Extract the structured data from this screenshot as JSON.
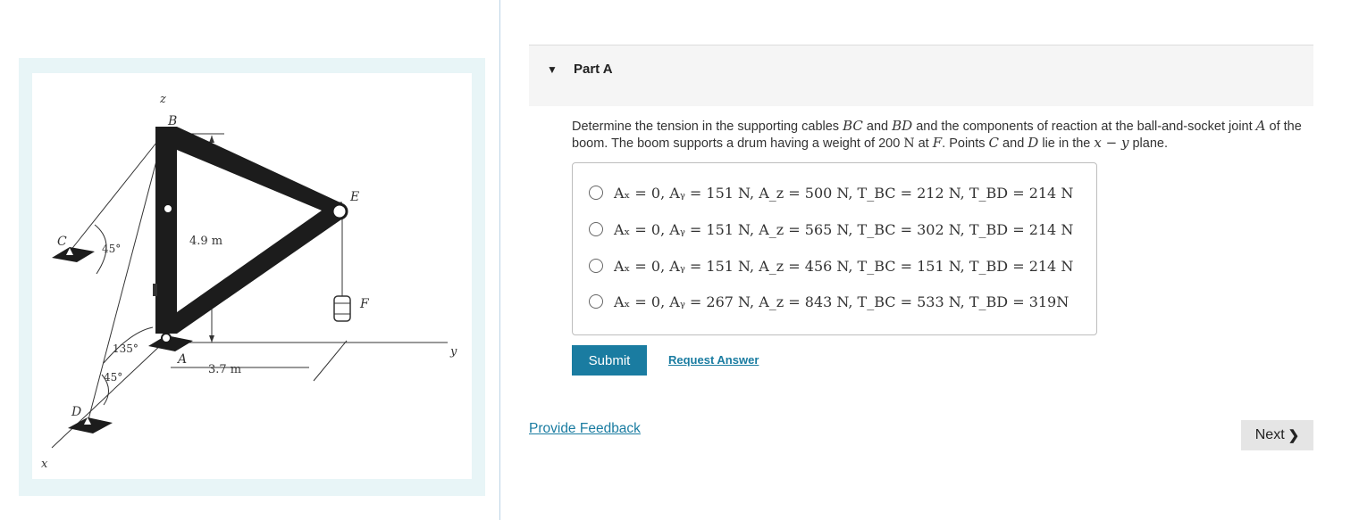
{
  "figure": {
    "labels": {
      "z": "z",
      "b": "B",
      "e": "E",
      "c": "C",
      "f": "F",
      "a": "A",
      "d": "D",
      "x": "x",
      "y": "y",
      "angle_c": "45°",
      "angle_d1": "135°",
      "angle_d2": "45°",
      "dim_height": "4.9 m",
      "dim_width": "3.7 m"
    }
  },
  "part": {
    "title": "Part A"
  },
  "question": {
    "t1": "Determine the tension in the supporting cables ",
    "m1": "BC",
    "t2": " and ",
    "m2": "BD",
    "t3": " and the components of reaction at the ball-and-socket joint ",
    "m3": "A",
    "t4": " of the boom. The boom supports a drum having a weight of 200 ",
    "m4": "N",
    "t5": " at ",
    "m5": "F",
    "t6": ". Points ",
    "m6": "C",
    "t7": " and ",
    "m7": "D",
    "t8": " lie in the ",
    "m8": "x − y",
    "t9": " plane."
  },
  "options": [
    {
      "text": "Aₓ = 0,  Aᵧ = 151 N,  A_z = 500 N,  T_BC = 212 N,  T_BD = 214 N"
    },
    {
      "text": "Aₓ = 0,  Aᵧ = 151 N,  A_z = 565 N,  T_BC = 302 N,  T_BD = 214 N"
    },
    {
      "text": "Aₓ = 0,  Aᵧ = 151 N,  A_z = 456 N,  T_BC = 151 N,  T_BD = 214 N"
    },
    {
      "text": "Aₓ = 0,  Aᵧ = 267 N,  A_z = 843 N,  T_BC = 533 N,  T_BD = 319N"
    }
  ],
  "buttons": {
    "submit": "Submit",
    "request_answer": "Request Answer",
    "provide_feedback": "Provide Feedback",
    "next": "Next"
  },
  "icons": {
    "caret": "caret-down-icon",
    "next_chevron": "chevron-right-icon"
  },
  "colors": {
    "accent": "#1a7ca1",
    "panel_bg": "#e8f5f7"
  }
}
